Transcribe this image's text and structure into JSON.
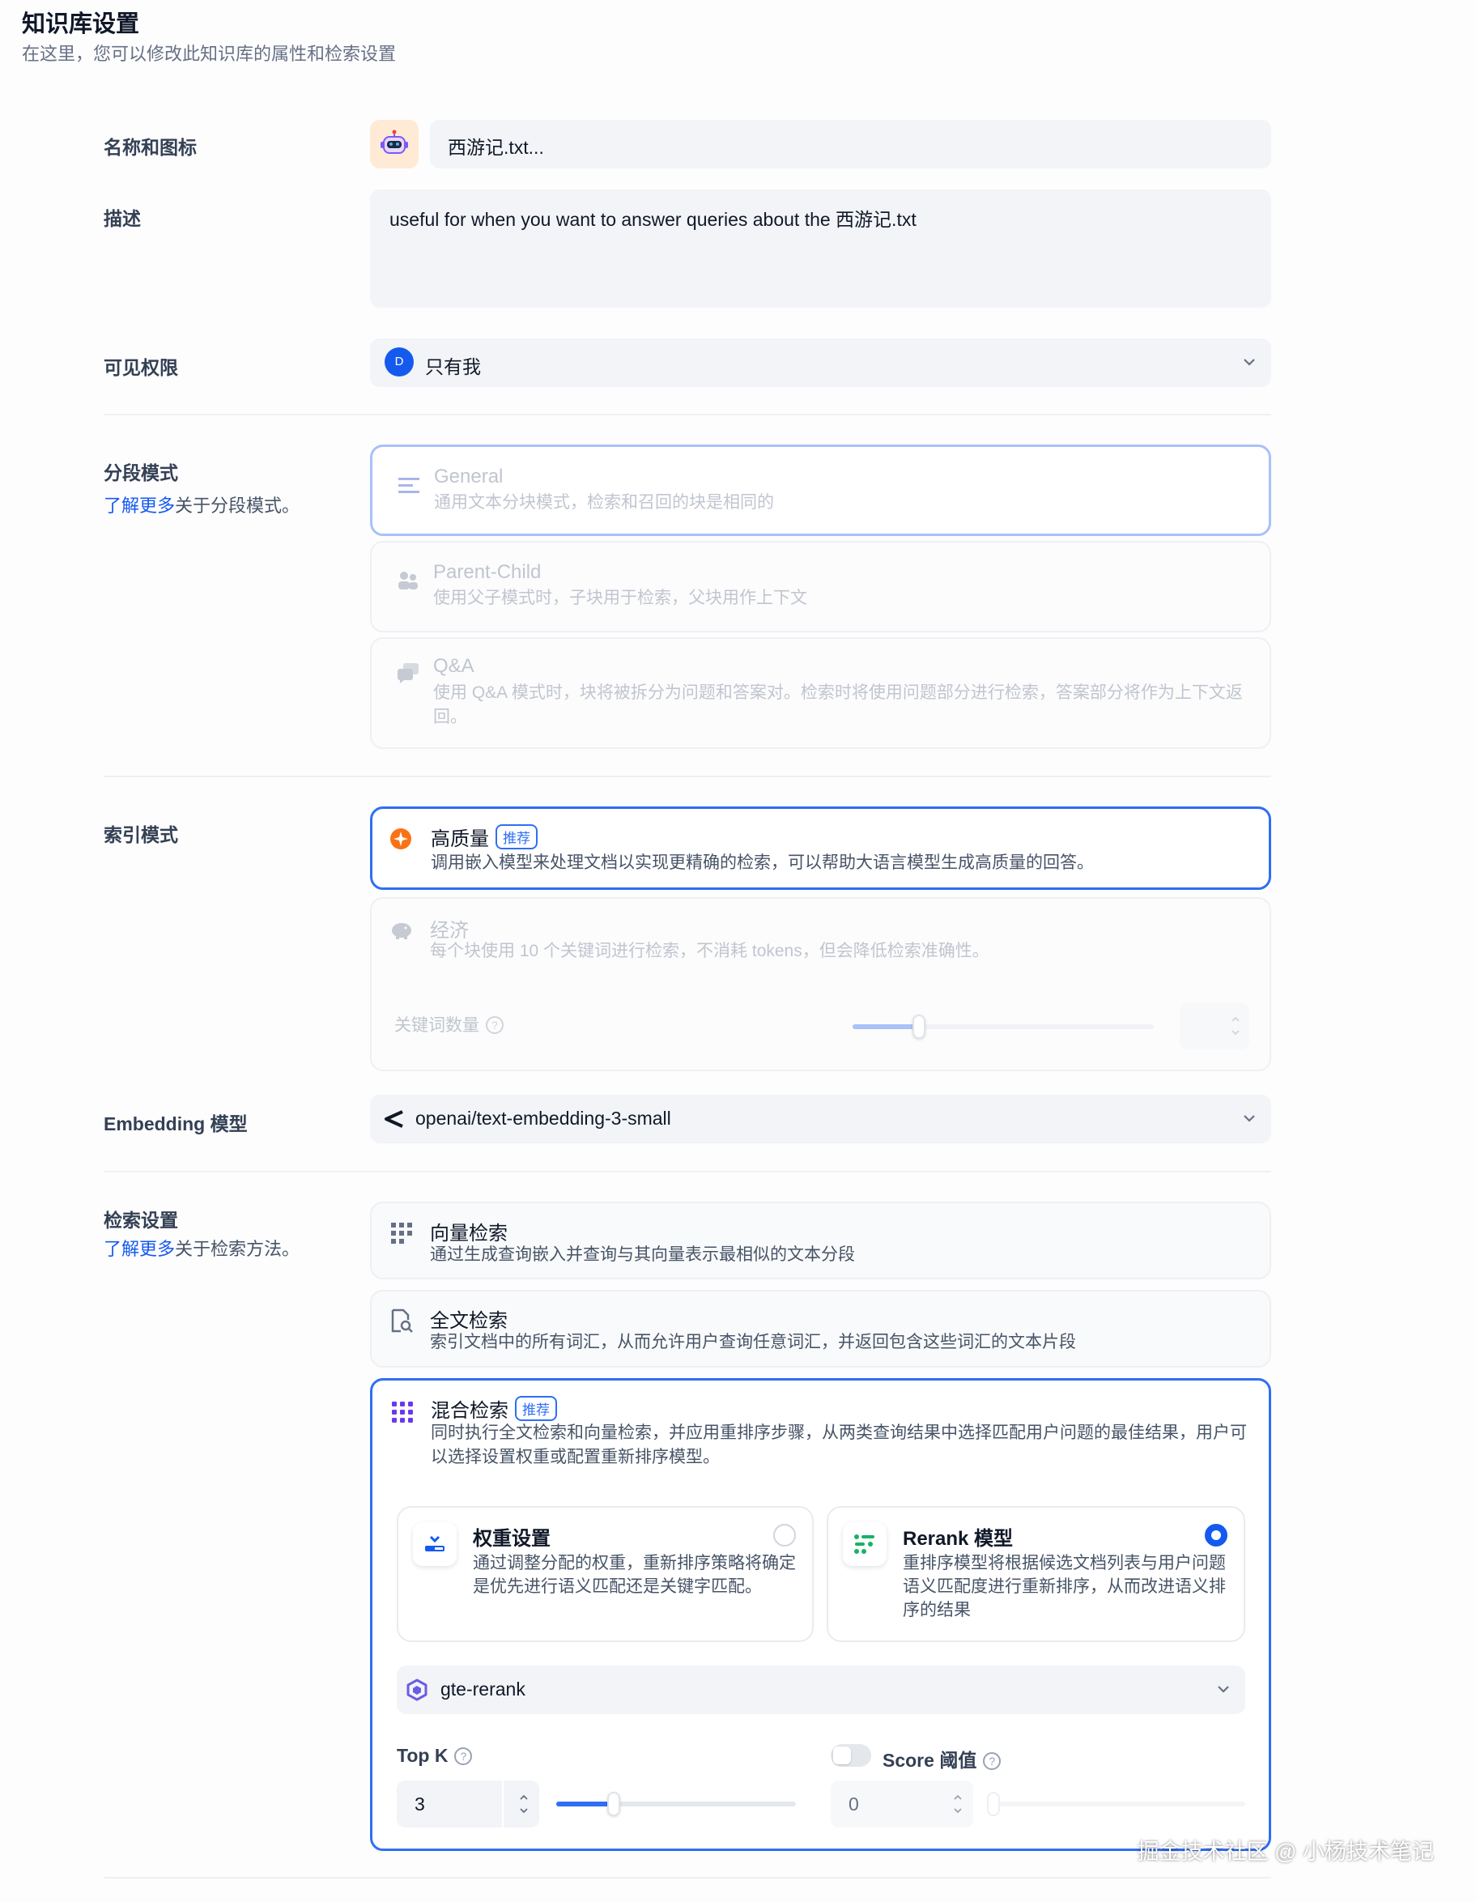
{
  "header": {
    "title": "知识库设置",
    "subtitle": "在这里，您可以修改此知识库的属性和检索设置"
  },
  "name_section": {
    "label": "名称和图标",
    "value": "西游记.txt..."
  },
  "desc_section": {
    "label": "描述",
    "value": "useful for when you want to answer queries about the 西游记.txt"
  },
  "permission": {
    "label": "可见权限",
    "avatar_letter": "D",
    "value": "只有我"
  },
  "chunk_mode": {
    "label": "分段模式",
    "learn_link": "了解更多",
    "learn_suffix": "关于分段模式。",
    "options": [
      {
        "title": "General",
        "desc": "通用文本分块模式，检索和召回的块是相同的",
        "icon": "list-icon"
      },
      {
        "title": "Parent-Child",
        "desc": "使用父子模式时，子块用于检索，父块用作上下文",
        "icon": "parent-child-icon"
      },
      {
        "title": "Q&A",
        "desc": "使用 Q&A 模式时，块将被拆分为问题和答案对。检索时将使用问题部分进行检索，答案部分将作为上下文返回。",
        "icon": "chat-icon"
      }
    ]
  },
  "index_mode": {
    "label": "索引模式",
    "high_quality": {
      "title": "高质量",
      "badge": "推荐",
      "desc": "调用嵌入模型来处理文档以实现更精确的检索，可以帮助大语言模型生成高质量的回答。"
    },
    "economy": {
      "title": "经济",
      "desc": "每个块使用 10 个关键词进行检索，不消耗 tokens，但会降低检索准确性。",
      "keyword_label": "关键词数量",
      "keyword_level": 0.22
    }
  },
  "embedding": {
    "label": "Embedding 模型",
    "value": "openai/text-embedding-3-small"
  },
  "retrieval": {
    "label": "检索设置",
    "learn_link": "了解更多",
    "learn_suffix": "关于检索方法。",
    "vector": {
      "title": "向量检索",
      "desc": "通过生成查询嵌入并查询与其向量表示最相似的文本分段"
    },
    "fulltext": {
      "title": "全文检索",
      "desc": "索引文档中的所有词汇，从而允许用户查询任意词汇，并返回包含这些词汇的文本片段"
    },
    "hybrid": {
      "title": "混合检索",
      "badge": "推荐",
      "desc": "同时执行全文检索和向量检索，并应用重排序步骤，从两类查询结果中选择匹配用户问题的最佳结果，用户可以选择设置权重或配置重新排序模型。",
      "weight_card": {
        "title": "权重设置",
        "desc": "通过调整分配的权重，重新排序策略将确定是优先进行语义匹配还是关键字匹配。"
      },
      "rerank_card": {
        "title": "Rerank 模型",
        "desc": "重排序模型将根据候选文档列表与用户问题语义匹配度进行重新排序，从而改进语义排序的结果"
      },
      "rerank_model": "gte-rerank",
      "top_k": {
        "label": "Top K",
        "value": "3",
        "level": 0.24
      },
      "score": {
        "label": "Score 阈值",
        "value": "0"
      }
    }
  },
  "watermark": "掘金技术社区 @ 小杨技术笔记",
  "colors": {
    "accent": "#155aef",
    "selected_border": "#2f6ef5"
  }
}
